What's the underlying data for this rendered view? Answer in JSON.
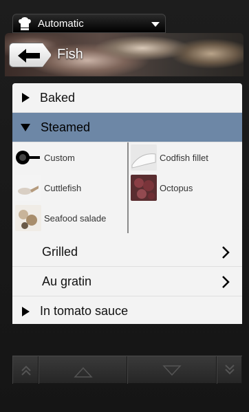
{
  "mode": {
    "label": "Automatic"
  },
  "header": {
    "title": "Fish"
  },
  "menu": {
    "baked": "Baked",
    "steamed": "Steamed",
    "grid": [
      {
        "label": "Custom"
      },
      {
        "label": "Codfish fillet"
      },
      {
        "label": "Cuttlefish"
      },
      {
        "label": "Octopus"
      },
      {
        "label": "Seafood salade"
      }
    ],
    "grilled": "Grilled",
    "au_gratin": "Au gratin",
    "tomato": "In tomato sauce"
  },
  "colors": {
    "selected": "#6d87a6",
    "panel": "#f3f3f3",
    "frame": "#1d1d1d"
  }
}
